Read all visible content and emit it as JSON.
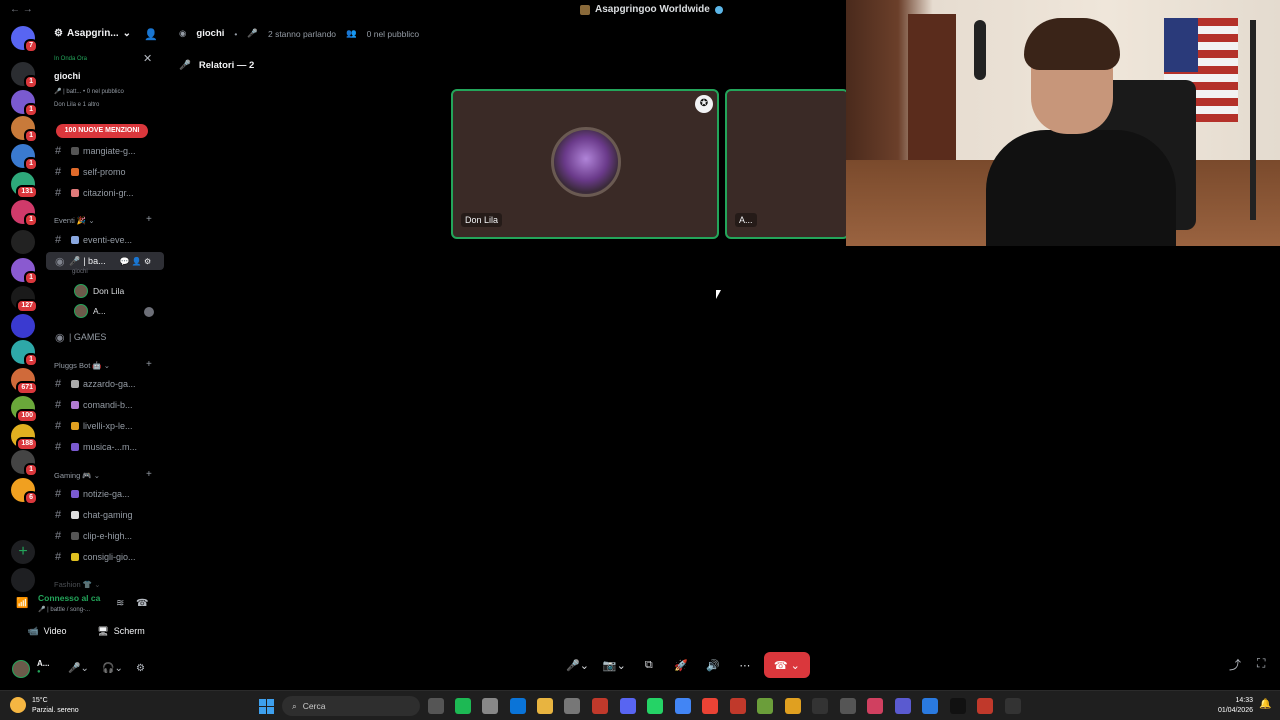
{
  "window": {
    "title": "Asapgringoo Worldwide",
    "nav": "←  →"
  },
  "server": {
    "name": "Asapgrin...",
    "chevron": "⌄"
  },
  "rail_servers": [
    {
      "color": "#5865f2",
      "badge": "7"
    },
    {
      "color": "#2b2d31",
      "badge": "1"
    },
    {
      "color": "#7a5ad0",
      "badge": "1"
    },
    {
      "color": "#c87a3a",
      "badge": "1"
    },
    {
      "color": "#3a7ad0",
      "badge": "1"
    },
    {
      "color": "#2ea87a",
      "badge": "131"
    },
    {
      "color": "#d03a6a",
      "badge": "1"
    },
    {
      "color": "#222222",
      "badge": ""
    },
    {
      "color": "#8a5ad0",
      "badge": "1"
    },
    {
      "color": "#1a1a1a",
      "badge": "127"
    },
    {
      "color": "#3a3ad0",
      "badge": ""
    },
    {
      "color": "#2ea8a8",
      "badge": "1"
    },
    {
      "color": "#d06a3a",
      "badge": "671"
    },
    {
      "color": "#6aa83a",
      "badge": "100"
    },
    {
      "color": "#e0b020",
      "badge": "188"
    },
    {
      "color": "#444444",
      "badge": "1"
    },
    {
      "color": "#f0a020",
      "badge": "6"
    }
  ],
  "live": {
    "label": "In Onda Ora",
    "name": "giochi",
    "meta": "🎤 | batt... • 0 nel pubblico",
    "meta2": "Don Lila e 1 altro",
    "close": "✕"
  },
  "mentions": "100 NUOVE MENZIONI",
  "channels": [
    {
      "label": "mangiate-g...",
      "color": "#555"
    },
    {
      "label": "self-promo",
      "color": "#e06a2a"
    },
    {
      "label": "citazioni-gr...",
      "color": "#e07a7a"
    }
  ],
  "cat_events": "Eventi 🎉 ⌄",
  "events_channel": "eventi-eve...",
  "voice_channel": {
    "label": "| ba...",
    "sub": "giochi"
  },
  "voice_users": [
    {
      "name": "Don Lila"
    },
    {
      "name": "A..."
    }
  ],
  "games_channel": "| GAMES",
  "cat_bot": "Pluggs Bot 🤖 ⌄",
  "bot_channels": [
    {
      "label": "azzardo-ga...",
      "color": "#aaa"
    },
    {
      "label": "comandi-b...",
      "color": "#b07ad0"
    },
    {
      "label": "livelli-xp-le...",
      "color": "#e0a020"
    },
    {
      "label": "musica-...m...",
      "color": "#7a5ad0"
    }
  ],
  "cat_gaming": "Gaming 🎮 ⌄",
  "gaming_channels": [
    {
      "label": "notizie-ga...",
      "color": "#7a5ad0"
    },
    {
      "label": "chat-gaming",
      "color": "#ddd"
    },
    {
      "label": "clip-e-high...",
      "color": "#555"
    },
    {
      "label": "consigli-gio...",
      "color": "#e0c020"
    }
  ],
  "cat_fashion": "Fashion 👕 ⌄",
  "voice_panel": {
    "status": "Connesso al ca",
    "channel": "🎤 | battle / song-...",
    "video": "Video",
    "screen": "Scherm"
  },
  "me": {
    "name": "A...",
    "status": "●"
  },
  "header": {
    "channel": "giochi",
    "speaking": "2 stanno parlando",
    "audience": "0 nel pubblico"
  },
  "speakers_label": "Relatori — 2",
  "tiles": [
    {
      "name": "Don Lila"
    },
    {
      "name": "A..."
    }
  ],
  "taskbar": {
    "temp": "15°C",
    "weather": "Parzial. sereno",
    "search": "Cerca",
    "time": "14:33",
    "date": "01/04/2026"
  },
  "taskbar_apps": [
    {
      "name": "task-view",
      "color": "#555"
    },
    {
      "name": "spotify",
      "color": "#1db954"
    },
    {
      "name": "settings",
      "color": "#888"
    },
    {
      "name": "store",
      "color": "#0a74d8"
    },
    {
      "name": "explorer",
      "color": "#e8b440"
    },
    {
      "name": "app-6",
      "color": "#777"
    },
    {
      "name": "app-7",
      "color": "#c0392b"
    },
    {
      "name": "discord",
      "color": "#5865f2"
    },
    {
      "name": "whatsapp",
      "color": "#25d366"
    },
    {
      "name": "chrome-1",
      "color": "#4285f4"
    },
    {
      "name": "chrome-2",
      "color": "#ea4335"
    },
    {
      "name": "app-12",
      "color": "#c0392b"
    },
    {
      "name": "app-13",
      "color": "#6b9e3a"
    },
    {
      "name": "app-14",
      "color": "#e0a020"
    },
    {
      "name": "app-15",
      "color": "#333"
    },
    {
      "name": "app-16",
      "color": "#555"
    },
    {
      "name": "app-17",
      "color": "#d04060"
    },
    {
      "name": "app-18",
      "color": "#5a5ad0"
    },
    {
      "name": "app-19",
      "color": "#2a7ae0"
    },
    {
      "name": "tiktok",
      "color": "#111"
    },
    {
      "name": "app-21",
      "color": "#c0392b"
    },
    {
      "name": "app-22",
      "color": "#333"
    }
  ]
}
